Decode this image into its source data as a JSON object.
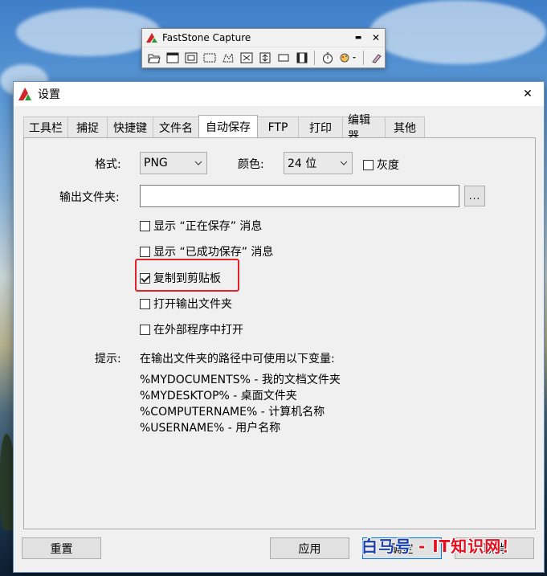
{
  "faststone": {
    "title": "FastStone Capture",
    "minimize": "▬",
    "close": "✕",
    "tools": [
      "open-icon",
      "window-icon",
      "object-icon",
      "rect-region-icon",
      "freehand-icon",
      "fullscreen-icon",
      "scroll-icon",
      "fixed-region-icon",
      "video-icon",
      "timer-icon",
      "settings-icon",
      "color-picker-icon"
    ]
  },
  "dialog": {
    "title": "设置",
    "close": "✕",
    "tabs": [
      {
        "label": "工具栏",
        "active": false
      },
      {
        "label": "捕捉",
        "active": false
      },
      {
        "label": "快捷键",
        "active": false
      },
      {
        "label": "文件名",
        "active": false
      },
      {
        "label": "自动保存",
        "active": true
      },
      {
        "label": "FTP",
        "active": false
      },
      {
        "label": "打印",
        "active": false
      },
      {
        "label": "编辑器",
        "active": false
      },
      {
        "label": "其他",
        "active": false
      }
    ],
    "format": {
      "label": "格式:",
      "value": "PNG"
    },
    "color": {
      "label": "颜色:",
      "value": "24 位"
    },
    "grayscale": {
      "label": "灰度",
      "checked": false
    },
    "output_folder": {
      "label": "输出文件夹:",
      "value": "",
      "browse": "..."
    },
    "options": [
      {
        "label": "显示 “正在保存” 消息",
        "checked": false
      },
      {
        "label": "显示 “已成功保存” 消息",
        "checked": false
      },
      {
        "label": "复制到剪贴板",
        "checked": true
      },
      {
        "label": "打开输出文件夹",
        "checked": false
      },
      {
        "label": "在外部程序中打开",
        "checked": false
      }
    ],
    "hint": {
      "label": "提示:",
      "intro": "在输出文件夹的路径中可使用以下变量:",
      "vars": [
        "%MYDOCUMENTS% - 我的文档文件夹",
        "%MYDESKTOP% - 桌面文件夹",
        "%COMPUTERNAME% - 计算机名称",
        "%USERNAME% - 用户名称"
      ]
    },
    "buttons": {
      "reset": "重置",
      "apply": "应用",
      "ok": "确定",
      "cancel": "取消"
    }
  },
  "watermark": {
    "part1": "白马号",
    "part2": " - IT知识网！"
  },
  "colors": {
    "highlight": "#e0242a",
    "accent": "#0078d7"
  }
}
